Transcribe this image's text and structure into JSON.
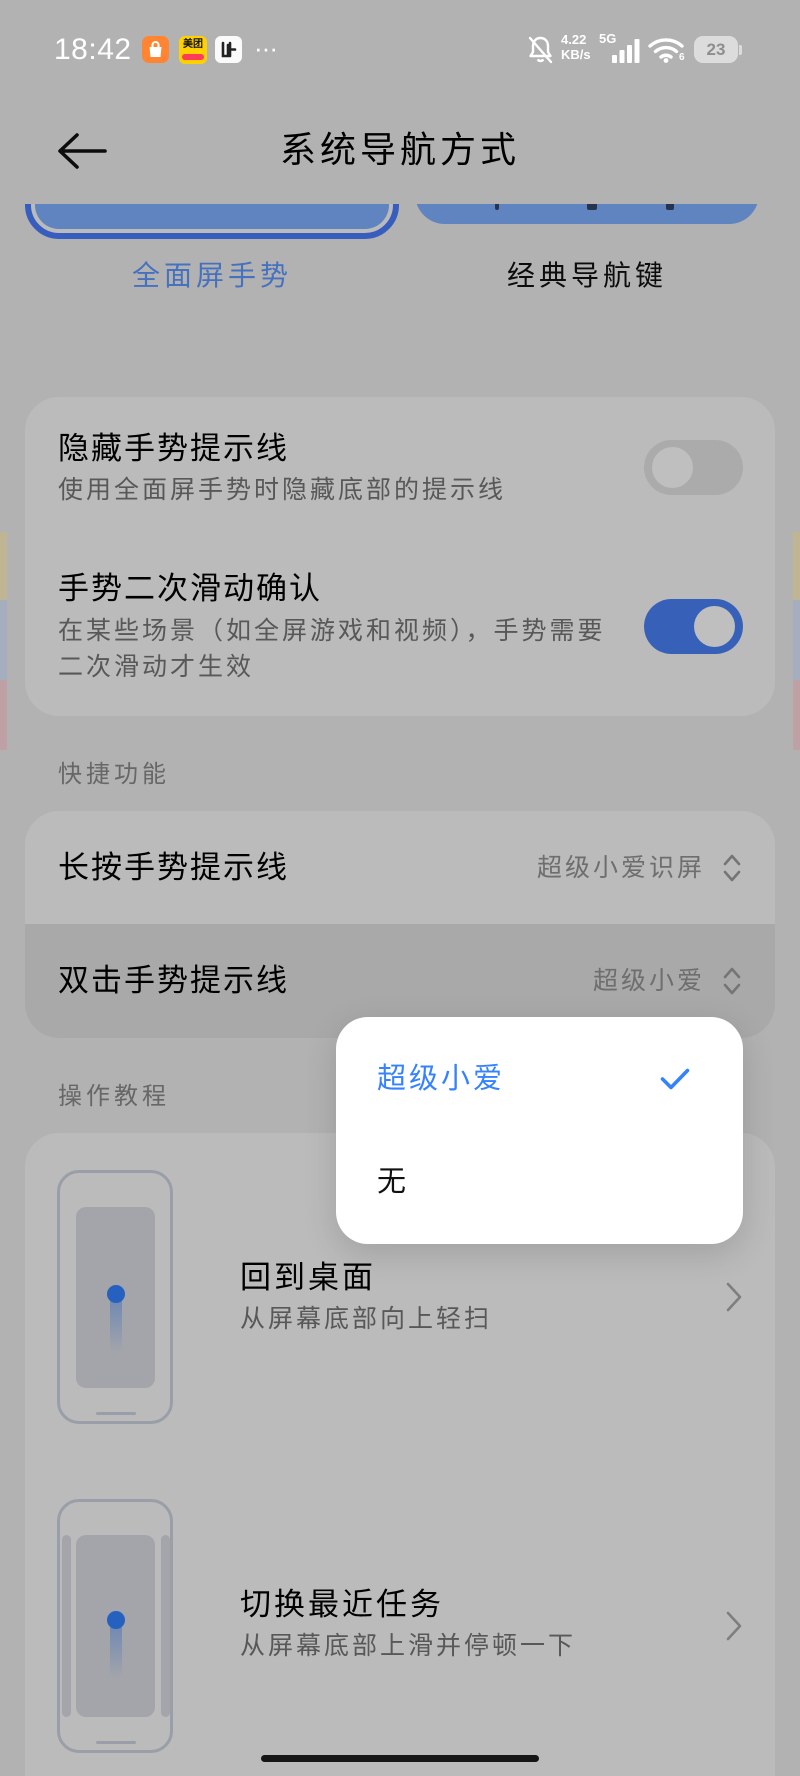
{
  "status_bar": {
    "time": "18:42",
    "notification_icons": [
      "shopping-bag-app-icon",
      "meituan-app-icon",
      "dark-app-icon"
    ],
    "meituan_label": "美团",
    "more_indicator": "···",
    "net_speed": "4.22",
    "net_speed_unit": "KB/s",
    "network_type": "5G",
    "wifi_badge": "6",
    "battery_level": "23"
  },
  "header": {
    "back_icon": "arrow-left-icon",
    "title": "系统导航方式"
  },
  "navigation_modes": [
    {
      "label": "全面屏手势",
      "selected": true
    },
    {
      "label": "经典导航键",
      "selected": false
    }
  ],
  "gesture_settings": [
    {
      "title": "隐藏手势提示线",
      "subtitle": "使用全面屏手势时隐藏底部的提示线",
      "enabled": false
    },
    {
      "title": "手势二次滑动确认",
      "subtitle": "在某些场景（如全屏游戏和视频），手势需要二次滑动才生效",
      "enabled": true
    }
  ],
  "shortcuts": {
    "section_title": "快捷功能",
    "items": [
      {
        "title": "长按手势提示线",
        "value": "超级小爱识屏",
        "pressed": false
      },
      {
        "title": "双击手势提示线",
        "value": "超级小爱",
        "pressed": true
      }
    ]
  },
  "tutorials": {
    "section_title": "操作教程",
    "items": [
      {
        "title": "回到桌面",
        "subtitle": "从屏幕底部向上轻扫"
      },
      {
        "title": "切换最近任务",
        "subtitle": "从屏幕底部上滑并停顿一下"
      }
    ]
  },
  "dropdown_menu": {
    "options": [
      {
        "label": "超级小爱",
        "selected": true
      },
      {
        "label": "无",
        "selected": false
      }
    ]
  },
  "colors": {
    "accent": "#3482FF",
    "scrim": "rgba(0,0,0,0.25)"
  }
}
